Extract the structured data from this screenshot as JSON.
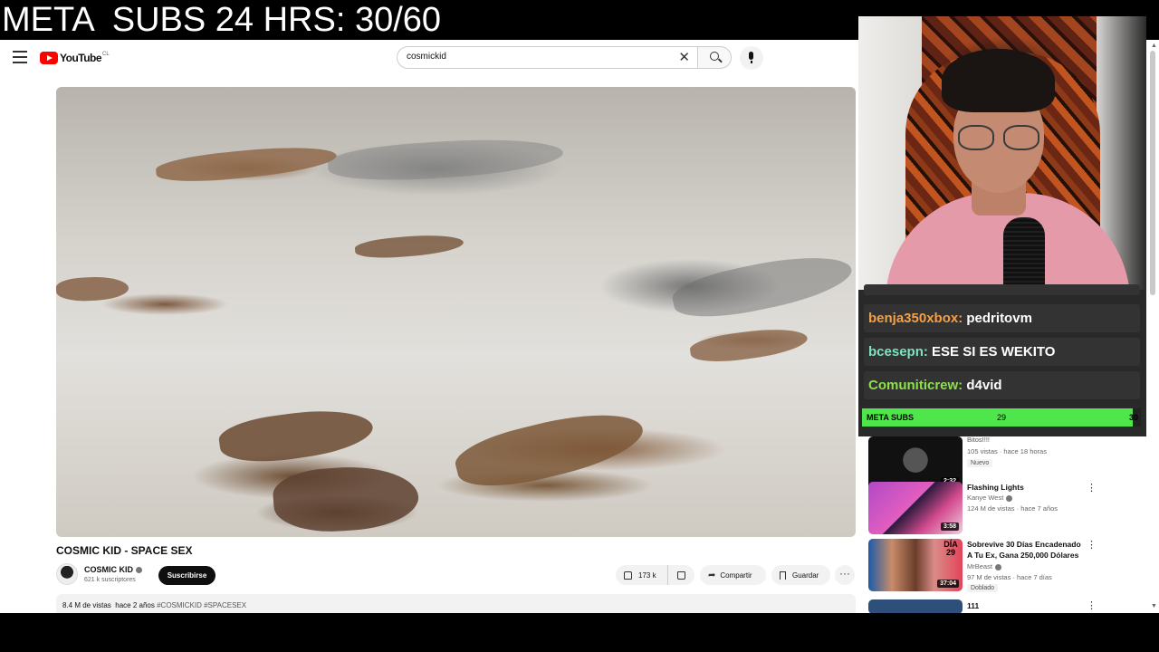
{
  "overlay": {
    "banner_text": "META  SUBS 24 HRS: 30/60"
  },
  "youtube": {
    "logo_text": "YouTube",
    "logo_country": "CL",
    "search": {
      "value": "cosmickid"
    },
    "video": {
      "title": "COSMIC KID - SPACE SEX",
      "channel": "COSMIC KID",
      "subscribers": "621 k suscriptores",
      "subscribe_label": "Suscribirse",
      "likes": "173 k",
      "share_label": "Compartir",
      "save_label": "Guardar",
      "views": "8.4 M de vistas",
      "age": "hace 2 años",
      "tags": "#COSMICKID #SPACESEX"
    },
    "recommendations": [
      {
        "title": "Bitos!!!!",
        "meta": "105 vistas · hace 18 horas",
        "badge": "Nuevo",
        "duration": "2:32"
      },
      {
        "title": "Flashing Lights",
        "channel": "Kanye West",
        "meta": "124 M de vistas · hace 7 años",
        "duration": "3:58"
      },
      {
        "title": "Sobrevive 30 Días Encadenado A Tu Ex, Gana 250,000 Dólares",
        "channel": "MrBeast",
        "meta": "97 M de vistas · hace 7 días",
        "badge": "Doblado",
        "duration": "37:04",
        "thumb_text": "DÍA 29"
      },
      {
        "title": "111"
      }
    ]
  },
  "chat": {
    "messages": [
      {
        "user": "benja350xbox:",
        "text": "pedritovm",
        "color": "#f5a046"
      },
      {
        "user": "bcesepn:",
        "text": "ESE SI ES WEKITO",
        "color": "#7de3c3"
      },
      {
        "user": "Comuniticrew:",
        "text": "d4vid",
        "color": "#8de04a"
      }
    ]
  },
  "goal": {
    "label": "META SUBS",
    "current": "29",
    "target": "30",
    "progress": 0.97,
    "color": "#4ee64a"
  }
}
